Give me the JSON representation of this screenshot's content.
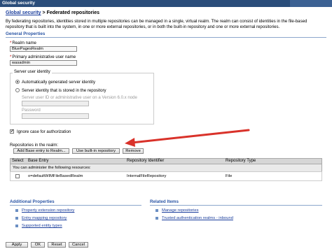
{
  "window": {
    "title": "Global security"
  },
  "breadcrumb": {
    "parent": "Global security",
    "separator": " > ",
    "current": "Federated repositories"
  },
  "description": "By federating repositories, identities stored in multiple repositories can be managed in a single, virtual realm. The realm can consist of identities in the file-based repository that is built into the system, in one or more external repositories, or in both the built-in repository and one or more external repositories.",
  "general": {
    "heading": "General Properties",
    "realm_label": "Realm name",
    "realm_value": "BluePagesRealm",
    "admin_label": "Primary administrative user name",
    "admin_value": "wasadmin",
    "identity": {
      "legend": "Server user identity",
      "option1": "Automatically generated server identity",
      "option2": "Server identity that is stored in the repository",
      "userid_label": "Server user ID or administrative user on a Version 6.0.x node",
      "password_label": "Password",
      "selected": "option1"
    },
    "ignore_case": {
      "label": "Ignore case for authorization",
      "checked": true
    }
  },
  "repositories": {
    "heading": "Repositories in the realm:",
    "buttons": {
      "add": "Add Base entry to Realm...",
      "builtin": "Use built-in repository",
      "remove": "Remove"
    },
    "columns": [
      "Select",
      "Base Entry",
      "Repository Identifier",
      "Repository Type"
    ],
    "admin_note": "You can administer the following resources:",
    "rows": [
      {
        "base_entry": "o=defaultWIMFileBasedRealm",
        "identifier": "InternalFileRepository",
        "type": "File"
      }
    ]
  },
  "additional": {
    "heading": "Additional Properties",
    "links": [
      "Property extension repository",
      "Entry mapping repository",
      "Supported entity types"
    ]
  },
  "related": {
    "heading": "Related Items",
    "links": [
      "Manage repositories",
      "Trusted authentication realms - inbound"
    ]
  },
  "footer": {
    "apply": "Apply",
    "ok": "OK",
    "reset": "Reset",
    "cancel": "Cancel"
  },
  "colors": {
    "titlebar": "#2a4d7a",
    "link": "#1a3d9c",
    "section": "#2a55a5",
    "arrow": "#d9322a"
  }
}
